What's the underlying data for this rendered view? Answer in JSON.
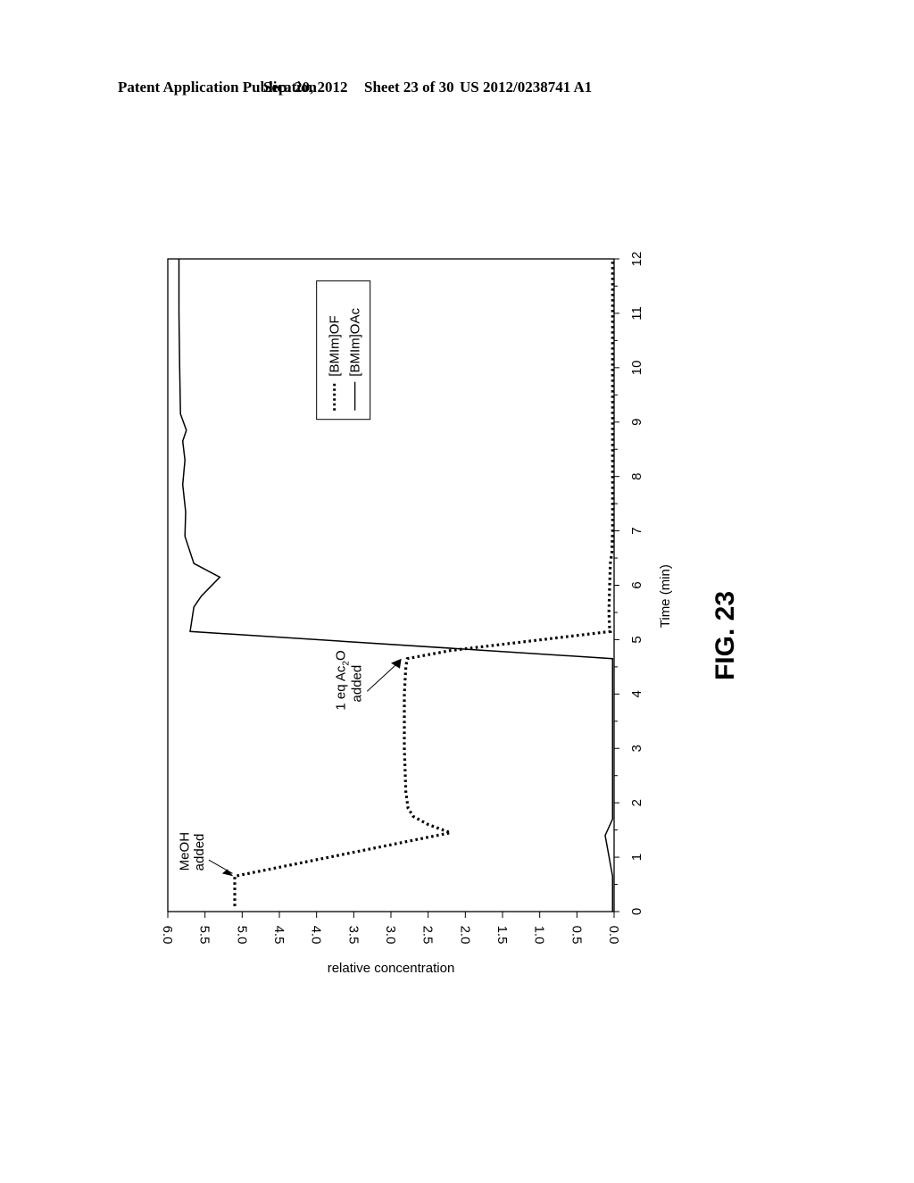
{
  "header": {
    "publication": "Patent Application Publication",
    "date": "Sep. 20, 2012",
    "sheet": "Sheet 23 of 30",
    "number": "US 2012/0238741 A1"
  },
  "figure_label": "FIG. 23",
  "chart_data": {
    "type": "line",
    "orientation": "rotated-90-ccw",
    "title": "",
    "xlabel": "Time (min)",
    "ylabel": "relative concentration",
    "xlim": [
      0,
      12
    ],
    "ylim": [
      0,
      6.0
    ],
    "xticks": [
      "0",
      "1",
      "2",
      "3",
      "4",
      "5",
      "6",
      "7",
      "8",
      "9",
      "10",
      "11",
      "12"
    ],
    "yticks": [
      "0.0",
      "0.5",
      "1.0",
      "1.5",
      "2.0",
      "2.5",
      "3.0",
      "3.5",
      "4.0",
      "4.5",
      "5.0",
      "5.5",
      "6.0"
    ],
    "grid": false,
    "legend": {
      "placement": "upper-center",
      "entries": [
        {
          "name": "[BMIm]OF",
          "style": "dotted"
        },
        {
          "name": "[BMIm]OAc",
          "style": "solid"
        }
      ]
    },
    "series": [
      {
        "name": "[BMIm]OF",
        "style": "dotted",
        "x": [
          0.1,
          0.65,
          1.45,
          1.6,
          1.75,
          1.9,
          2.2,
          3.0,
          4.0,
          4.5,
          4.65,
          4.8,
          5.15,
          5.2,
          5.5,
          6.0,
          6.4,
          6.6,
          7.0,
          8.0,
          9.0,
          10.0,
          11.0,
          12.0
        ],
        "y": [
          5.1,
          5.1,
          2.2,
          2.5,
          2.7,
          2.77,
          2.8,
          2.82,
          2.82,
          2.8,
          2.78,
          2.2,
          0.05,
          0.06,
          0.07,
          0.06,
          0.05,
          0.03,
          0.02,
          0.02,
          0.02,
          0.02,
          0.02,
          0.02
        ]
      },
      {
        "name": "[BMIm]OAc",
        "style": "solid",
        "x": [
          0.0,
          0.65,
          1.4,
          1.7,
          2.0,
          3.0,
          4.0,
          4.65,
          5.15,
          5.6,
          5.8,
          6.15,
          6.4,
          6.9,
          7.35,
          7.85,
          8.3,
          8.65,
          8.85,
          9.15,
          10.0,
          11.0,
          12.0
        ],
        "y": [
          0.02,
          0.02,
          0.12,
          0.02,
          0.02,
          0.02,
          0.02,
          0.02,
          5.7,
          5.65,
          5.55,
          5.3,
          5.65,
          5.77,
          5.76,
          5.8,
          5.77,
          5.8,
          5.75,
          5.83,
          5.84,
          5.85,
          5.85
        ]
      }
    ],
    "annotations": [
      {
        "text_line1": "MeOH",
        "text_line2": "added",
        "x": 0.65,
        "y": 5.1
      },
      {
        "text_line1": "1 eq Ac",
        "subscript": "2",
        "text_line1_suffix": "O",
        "text_line2": "added",
        "x": 4.65,
        "y": 2.82
      }
    ]
  }
}
